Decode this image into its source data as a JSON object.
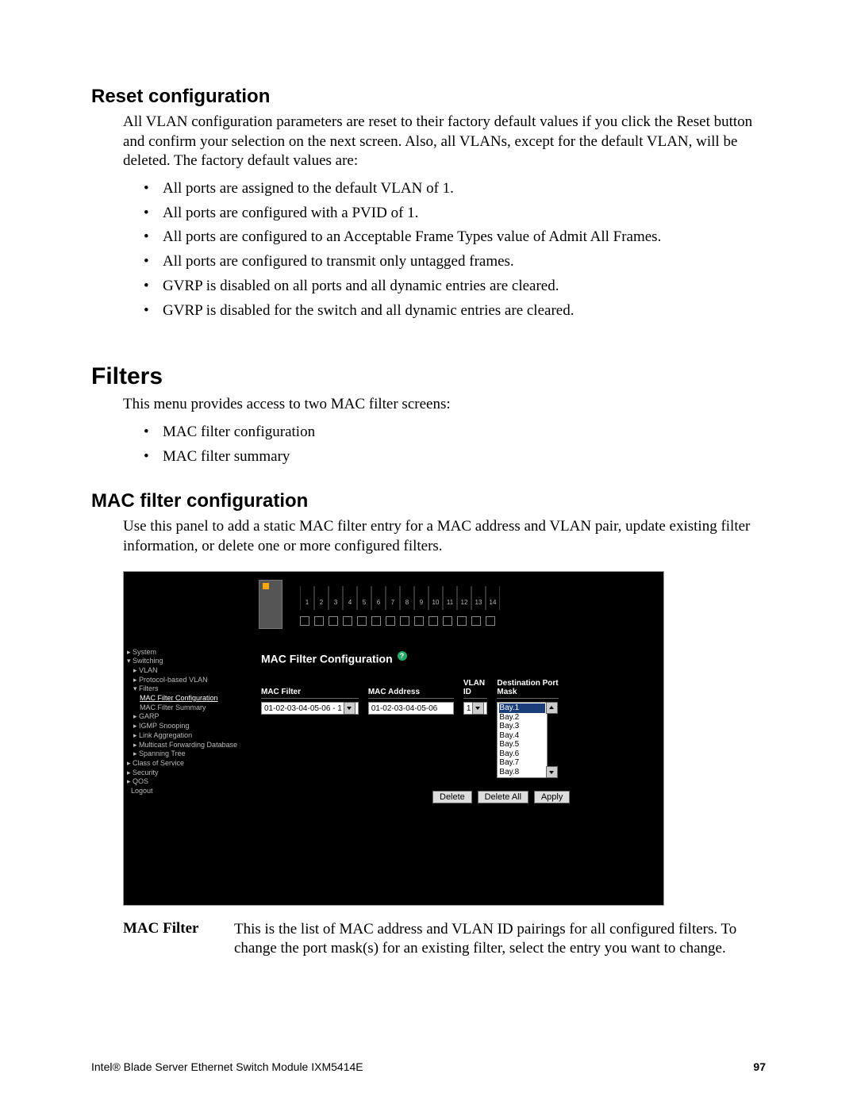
{
  "reset": {
    "heading": "Reset configuration",
    "intro": "All VLAN configuration parameters are reset to their factory default values if you click the Reset button and confirm your selection on the next screen. Also, all VLANs, except for the default VLAN, will be deleted. The factory default values are:",
    "bullets": [
      "All ports are assigned to the default VLAN of 1.",
      "All ports are configured with a PVID of 1.",
      "All ports are configured to an Acceptable Frame Types value of Admit All Frames.",
      "All ports are configured to transmit only untagged frames.",
      "GVRP is disabled on all ports and all dynamic entries are cleared.",
      "GVRP is disabled for the switch and all dynamic entries are cleared."
    ]
  },
  "filters": {
    "heading": "Filters",
    "intro": "This menu provides access to two MAC filter screens:",
    "bullets": [
      "MAC filter configuration",
      "MAC filter summary"
    ]
  },
  "macfilter": {
    "heading": "MAC filter configuration",
    "intro": "Use this panel to add a static MAC filter entry for a MAC address and VLAN pair, update existing filter information, or delete one or more configured filters."
  },
  "screenshot": {
    "nav": [
      {
        "label": "System",
        "cls": "i1"
      },
      {
        "label": "Switching",
        "cls": "i1"
      },
      {
        "label": "VLAN",
        "cls": "i2"
      },
      {
        "label": "Protocol-based VLAN",
        "cls": "i2"
      },
      {
        "label": "Filters",
        "cls": "i2"
      },
      {
        "label": "MAC Filter Configuration",
        "cls": "i3 sel"
      },
      {
        "label": "MAC Filter Summary",
        "cls": "i3"
      },
      {
        "label": "GARP",
        "cls": "i2"
      },
      {
        "label": "IGMP Snooping",
        "cls": "i2"
      },
      {
        "label": "Link Aggregation",
        "cls": "i2"
      },
      {
        "label": "Multicast Forwarding Database",
        "cls": "i2"
      },
      {
        "label": "Spanning Tree",
        "cls": "i2"
      },
      {
        "label": "Class of Service",
        "cls": "i1"
      },
      {
        "label": "Security",
        "cls": "i1"
      },
      {
        "label": "QOS",
        "cls": "i1"
      },
      {
        "label": "Logout",
        "cls": "i1"
      }
    ],
    "title": "MAC Filter Configuration",
    "help": "?",
    "columns": {
      "mac_filter": {
        "hdr": "MAC Filter",
        "value": "01-02-03-04-05-06 - 1"
      },
      "mac_address": {
        "hdr": "MAC Address",
        "value": "01-02-03-04-05-06"
      },
      "vlan_id": {
        "hdr": "VLAN\nID",
        "value": "1"
      },
      "dest_port": {
        "hdr": "Destination Port\nMask",
        "items": [
          "Bay.1",
          "Bay.2",
          "Bay.3",
          "Bay.4",
          "Bay.5",
          "Bay.6",
          "Bay.7",
          "Bay.8"
        ]
      }
    },
    "port_numbers": [
      "1",
      "2",
      "3",
      "4",
      "5",
      "6",
      "7",
      "8",
      "9",
      "10",
      "11",
      "12",
      "13",
      "14"
    ],
    "buttons": {
      "delete": "Delete",
      "delete_all": "Delete All",
      "apply": "Apply"
    }
  },
  "definition": {
    "term": "MAC Filter",
    "desc": "This is the list of MAC address and VLAN ID pairings for all configured filters. To change the port mask(s) for an existing filter, select the entry you want to change."
  },
  "footer": {
    "left": "Intel® Blade Server Ethernet Switch Module IXM5414E",
    "page": "97"
  }
}
